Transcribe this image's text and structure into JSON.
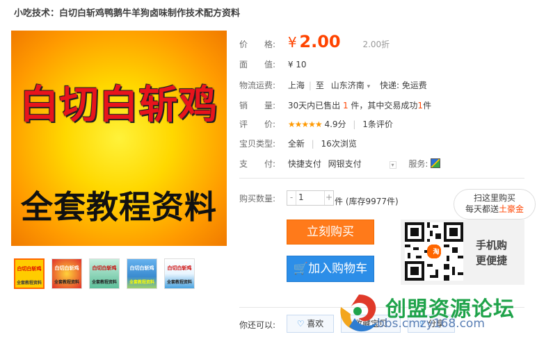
{
  "title": "小吃技术：白切白斩鸡鸭鹅牛羊狗卤味制作技术配方资料",
  "main_image": {
    "line1": "白切白斩鸡",
    "line2": "全套教程资料"
  },
  "thumbnails": [
    {
      "t1": "白切白斩鸡",
      "t2": "全套教程资料",
      "bg": "#ffcc00"
    },
    {
      "t1": "白切白斩鸡",
      "t2": "全套教程资料",
      "bg": "#e0302a"
    },
    {
      "t1": "白切白斩鸡",
      "t2": "全套教程资料",
      "bg": "#5dbf9a"
    },
    {
      "t1": "白切白斩鸡",
      "t2": "全套教程资料",
      "bg": "#3a8bd0"
    },
    {
      "t1": "白切白斩鸡",
      "t2": "全套教程资料",
      "bg": "#4aa3e0"
    }
  ],
  "price": {
    "label": "价　　格:",
    "symbol": "¥",
    "value": "2.00",
    "discount": "2.00折"
  },
  "face_value": {
    "label": "面　　值:",
    "value": "¥ 10"
  },
  "shipping": {
    "label": "物流运费:",
    "from": "上海",
    "to_label": "至",
    "to": "山东济南",
    "express": "快递: 免运费"
  },
  "sales": {
    "label": "销　　量:",
    "sold_prefix": "30天内已售出",
    "sold": "1",
    "sold_unit": "件，其中交易成功",
    "success": "1",
    "success_unit": "件"
  },
  "rating": {
    "label": "评　　价:",
    "stars": "★★★★★",
    "score": "4.9分",
    "reviews": "1条评价"
  },
  "item_type": {
    "label": "宝贝类型:",
    "condition": "全新",
    "views": "16次浏览"
  },
  "payment": {
    "label": "支　　付:",
    "method1": "快捷支付",
    "method2": "网银支付",
    "service_label": "服务:"
  },
  "quantity": {
    "label": "购买数量:",
    "value": "1",
    "unit": "件 (库存9977件)"
  },
  "buttons": {
    "buy": "立刻购买",
    "cart": "加入购物车"
  },
  "mobile": {
    "tip_line1": "扫这里购买",
    "tip_line2_prefix": "每天都送",
    "tip_highlight": "土豪金",
    "promo_line1": "手机购",
    "promo_line2": "更便捷",
    "qr_badge": "淘"
  },
  "share": {
    "label": "你还可以:",
    "like": "喜欢",
    "favorite": "收藏宝贝",
    "share": "分享"
  },
  "watermark": {
    "title": "创盟资源论坛",
    "url": "bbs.cmzy168.com"
  }
}
